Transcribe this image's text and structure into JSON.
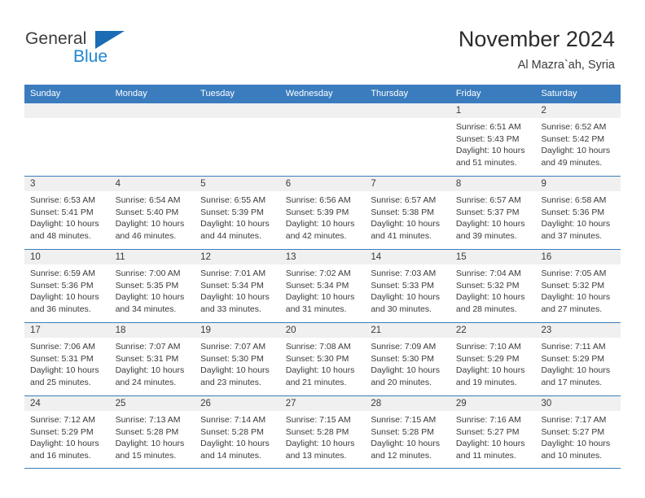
{
  "brand": {
    "name_part1": "General",
    "name_part2": "Blue",
    "logo_icon": "blue-triangle-icon"
  },
  "header": {
    "title": "November 2024",
    "subtitle": "Al Mazra`ah, Syria"
  },
  "colors": {
    "header_blue": "#3a7cbe",
    "brand_blue": "#1f86d0",
    "logo_blue": "#1b6cb5",
    "day_head_gray": "#f0f0f0",
    "text": "#3a3a3a"
  },
  "weekdays": [
    "Sunday",
    "Monday",
    "Tuesday",
    "Wednesday",
    "Thursday",
    "Friday",
    "Saturday"
  ],
  "labels": {
    "sunrise": "Sunrise:",
    "sunset": "Sunset:",
    "daylight": "Daylight:"
  },
  "weeks": [
    [
      {
        "day": "",
        "sunrise": "",
        "sunset": "",
        "daylight": ""
      },
      {
        "day": "",
        "sunrise": "",
        "sunset": "",
        "daylight": ""
      },
      {
        "day": "",
        "sunrise": "",
        "sunset": "",
        "daylight": ""
      },
      {
        "day": "",
        "sunrise": "",
        "sunset": "",
        "daylight": ""
      },
      {
        "day": "",
        "sunrise": "",
        "sunset": "",
        "daylight": ""
      },
      {
        "day": "1",
        "sunrise": "Sunrise: 6:51 AM",
        "sunset": "Sunset: 5:43 PM",
        "daylight": "Daylight: 10 hours and 51 minutes."
      },
      {
        "day": "2",
        "sunrise": "Sunrise: 6:52 AM",
        "sunset": "Sunset: 5:42 PM",
        "daylight": "Daylight: 10 hours and 49 minutes."
      }
    ],
    [
      {
        "day": "3",
        "sunrise": "Sunrise: 6:53 AM",
        "sunset": "Sunset: 5:41 PM",
        "daylight": "Daylight: 10 hours and 48 minutes."
      },
      {
        "day": "4",
        "sunrise": "Sunrise: 6:54 AM",
        "sunset": "Sunset: 5:40 PM",
        "daylight": "Daylight: 10 hours and 46 minutes."
      },
      {
        "day": "5",
        "sunrise": "Sunrise: 6:55 AM",
        "sunset": "Sunset: 5:39 PM",
        "daylight": "Daylight: 10 hours and 44 minutes."
      },
      {
        "day": "6",
        "sunrise": "Sunrise: 6:56 AM",
        "sunset": "Sunset: 5:39 PM",
        "daylight": "Daylight: 10 hours and 42 minutes."
      },
      {
        "day": "7",
        "sunrise": "Sunrise: 6:57 AM",
        "sunset": "Sunset: 5:38 PM",
        "daylight": "Daylight: 10 hours and 41 minutes."
      },
      {
        "day": "8",
        "sunrise": "Sunrise: 6:57 AM",
        "sunset": "Sunset: 5:37 PM",
        "daylight": "Daylight: 10 hours and 39 minutes."
      },
      {
        "day": "9",
        "sunrise": "Sunrise: 6:58 AM",
        "sunset": "Sunset: 5:36 PM",
        "daylight": "Daylight: 10 hours and 37 minutes."
      }
    ],
    [
      {
        "day": "10",
        "sunrise": "Sunrise: 6:59 AM",
        "sunset": "Sunset: 5:36 PM",
        "daylight": "Daylight: 10 hours and 36 minutes."
      },
      {
        "day": "11",
        "sunrise": "Sunrise: 7:00 AM",
        "sunset": "Sunset: 5:35 PM",
        "daylight": "Daylight: 10 hours and 34 minutes."
      },
      {
        "day": "12",
        "sunrise": "Sunrise: 7:01 AM",
        "sunset": "Sunset: 5:34 PM",
        "daylight": "Daylight: 10 hours and 33 minutes."
      },
      {
        "day": "13",
        "sunrise": "Sunrise: 7:02 AM",
        "sunset": "Sunset: 5:34 PM",
        "daylight": "Daylight: 10 hours and 31 minutes."
      },
      {
        "day": "14",
        "sunrise": "Sunrise: 7:03 AM",
        "sunset": "Sunset: 5:33 PM",
        "daylight": "Daylight: 10 hours and 30 minutes."
      },
      {
        "day": "15",
        "sunrise": "Sunrise: 7:04 AM",
        "sunset": "Sunset: 5:32 PM",
        "daylight": "Daylight: 10 hours and 28 minutes."
      },
      {
        "day": "16",
        "sunrise": "Sunrise: 7:05 AM",
        "sunset": "Sunset: 5:32 PM",
        "daylight": "Daylight: 10 hours and 27 minutes."
      }
    ],
    [
      {
        "day": "17",
        "sunrise": "Sunrise: 7:06 AM",
        "sunset": "Sunset: 5:31 PM",
        "daylight": "Daylight: 10 hours and 25 minutes."
      },
      {
        "day": "18",
        "sunrise": "Sunrise: 7:07 AM",
        "sunset": "Sunset: 5:31 PM",
        "daylight": "Daylight: 10 hours and 24 minutes."
      },
      {
        "day": "19",
        "sunrise": "Sunrise: 7:07 AM",
        "sunset": "Sunset: 5:30 PM",
        "daylight": "Daylight: 10 hours and 23 minutes."
      },
      {
        "day": "20",
        "sunrise": "Sunrise: 7:08 AM",
        "sunset": "Sunset: 5:30 PM",
        "daylight": "Daylight: 10 hours and 21 minutes."
      },
      {
        "day": "21",
        "sunrise": "Sunrise: 7:09 AM",
        "sunset": "Sunset: 5:30 PM",
        "daylight": "Daylight: 10 hours and 20 minutes."
      },
      {
        "day": "22",
        "sunrise": "Sunrise: 7:10 AM",
        "sunset": "Sunset: 5:29 PM",
        "daylight": "Daylight: 10 hours and 19 minutes."
      },
      {
        "day": "23",
        "sunrise": "Sunrise: 7:11 AM",
        "sunset": "Sunset: 5:29 PM",
        "daylight": "Daylight: 10 hours and 17 minutes."
      }
    ],
    [
      {
        "day": "24",
        "sunrise": "Sunrise: 7:12 AM",
        "sunset": "Sunset: 5:29 PM",
        "daylight": "Daylight: 10 hours and 16 minutes."
      },
      {
        "day": "25",
        "sunrise": "Sunrise: 7:13 AM",
        "sunset": "Sunset: 5:28 PM",
        "daylight": "Daylight: 10 hours and 15 minutes."
      },
      {
        "day": "26",
        "sunrise": "Sunrise: 7:14 AM",
        "sunset": "Sunset: 5:28 PM",
        "daylight": "Daylight: 10 hours and 14 minutes."
      },
      {
        "day": "27",
        "sunrise": "Sunrise: 7:15 AM",
        "sunset": "Sunset: 5:28 PM",
        "daylight": "Daylight: 10 hours and 13 minutes."
      },
      {
        "day": "28",
        "sunrise": "Sunrise: 7:15 AM",
        "sunset": "Sunset: 5:28 PM",
        "daylight": "Daylight: 10 hours and 12 minutes."
      },
      {
        "day": "29",
        "sunrise": "Sunrise: 7:16 AM",
        "sunset": "Sunset: 5:27 PM",
        "daylight": "Daylight: 10 hours and 11 minutes."
      },
      {
        "day": "30",
        "sunrise": "Sunrise: 7:17 AM",
        "sunset": "Sunset: 5:27 PM",
        "daylight": "Daylight: 10 hours and 10 minutes."
      }
    ]
  ]
}
